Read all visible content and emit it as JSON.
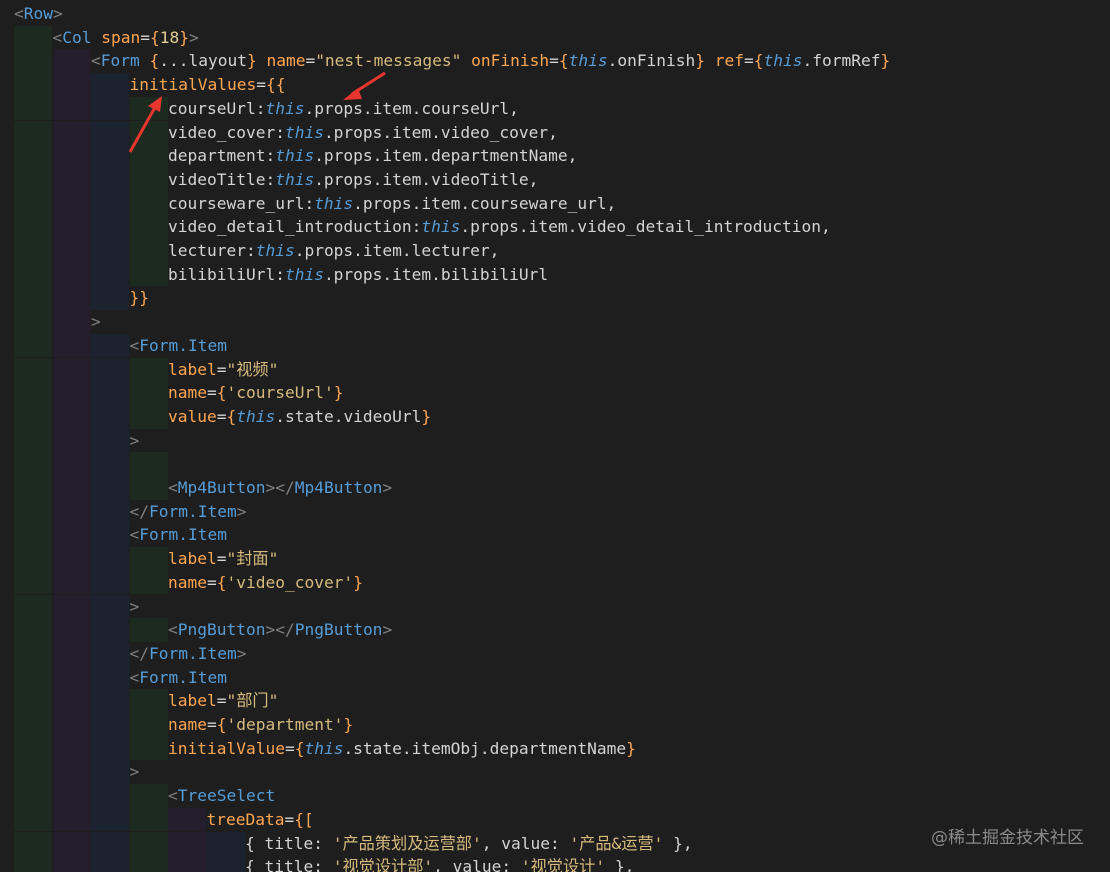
{
  "lines": [
    {
      "indent": 0,
      "tokens": [
        [
          "<",
          "brk"
        ],
        [
          "Row",
          "tagb"
        ],
        [
          ">",
          "brk"
        ]
      ]
    },
    {
      "indent": 1,
      "tokens": [
        [
          "<",
          "brk"
        ],
        [
          "Col",
          "tagb"
        ],
        [
          " ",
          "txt"
        ],
        [
          "span",
          "attr"
        ],
        [
          "=",
          "eq"
        ],
        [
          "{",
          "brace"
        ],
        [
          "18",
          "num"
        ],
        [
          "}",
          "brace"
        ],
        [
          ">",
          "brk"
        ]
      ]
    },
    {
      "indent": 2,
      "tokens": [
        [
          "<",
          "brk"
        ],
        [
          "Form",
          "tagb"
        ],
        [
          " ",
          "txt"
        ],
        [
          "{",
          "brace"
        ],
        [
          "...layout",
          "id"
        ],
        [
          "}",
          "brace"
        ],
        [
          " ",
          "txt"
        ],
        [
          "name",
          "attr"
        ],
        [
          "=",
          "eq"
        ],
        [
          "\"nest-messages\"",
          "str"
        ],
        [
          " ",
          "txt"
        ],
        [
          "onFinish",
          "attr"
        ],
        [
          "=",
          "eq"
        ],
        [
          "{",
          "brace"
        ],
        [
          "this",
          "this"
        ],
        [
          ".onFinish",
          "id"
        ],
        [
          "}",
          "brace"
        ],
        [
          " ",
          "txt"
        ],
        [
          "ref",
          "attr"
        ],
        [
          "=",
          "eq"
        ],
        [
          "{",
          "brace"
        ],
        [
          "this",
          "this"
        ],
        [
          ".formRef",
          "id"
        ],
        [
          "}",
          "brace"
        ]
      ]
    },
    {
      "indent": 3,
      "tokens": [
        [
          "initialValues",
          "attr"
        ],
        [
          "=",
          "eq"
        ],
        [
          "{{",
          "brace"
        ]
      ]
    },
    {
      "indent": 4,
      "tokens": [
        [
          "courseUrl:",
          "id"
        ],
        [
          "this",
          "this"
        ],
        [
          ".props.item.courseUrl,",
          "id"
        ]
      ]
    },
    {
      "indent": 4,
      "tokens": [
        [
          "video_cover:",
          "id"
        ],
        [
          "this",
          "this"
        ],
        [
          ".props.item.video_cover,",
          "id"
        ]
      ]
    },
    {
      "indent": 4,
      "tokens": [
        [
          "department:",
          "id"
        ],
        [
          "this",
          "this"
        ],
        [
          ".props.item.departmentName,",
          "id"
        ]
      ]
    },
    {
      "indent": 4,
      "tokens": [
        [
          "videoTitle:",
          "id"
        ],
        [
          "this",
          "this"
        ],
        [
          ".props.item.videoTitle,",
          "id"
        ]
      ]
    },
    {
      "indent": 4,
      "tokens": [
        [
          "courseware_url:",
          "id"
        ],
        [
          "this",
          "this"
        ],
        [
          ".props.item.courseware_url,",
          "id"
        ]
      ]
    },
    {
      "indent": 4,
      "tokens": [
        [
          "video_detail_introduction:",
          "id"
        ],
        [
          "this",
          "this"
        ],
        [
          ".props.item.video_detail_introduction,",
          "id"
        ]
      ]
    },
    {
      "indent": 4,
      "tokens": [
        [
          "lecturer:",
          "id"
        ],
        [
          "this",
          "this"
        ],
        [
          ".props.item.lecturer,",
          "id"
        ]
      ]
    },
    {
      "indent": 4,
      "tokens": [
        [
          "bilibiliUrl:",
          "id"
        ],
        [
          "this",
          "this"
        ],
        [
          ".props.item.bilibiliUrl",
          "id"
        ]
      ]
    },
    {
      "indent": 3,
      "tokens": [
        [
          "}}",
          "brace"
        ]
      ]
    },
    {
      "indent": 2,
      "tokens": [
        [
          ">",
          "brk"
        ]
      ]
    },
    {
      "indent": 3,
      "tokens": [
        [
          "<",
          "brk"
        ],
        [
          "Form.Item",
          "tagb"
        ]
      ]
    },
    {
      "indent": 4,
      "tokens": [
        [
          "label",
          "attr"
        ],
        [
          "=",
          "eq"
        ],
        [
          "\"视频\"",
          "str"
        ]
      ]
    },
    {
      "indent": 4,
      "tokens": [
        [
          "name",
          "attr"
        ],
        [
          "=",
          "eq"
        ],
        [
          "{",
          "brace"
        ],
        [
          "'courseUrl'",
          "str"
        ],
        [
          "}",
          "brace"
        ]
      ]
    },
    {
      "indent": 4,
      "tokens": [
        [
          "value",
          "attr"
        ],
        [
          "=",
          "eq"
        ],
        [
          "{",
          "brace"
        ],
        [
          "this",
          "this"
        ],
        [
          ".state.videoUrl",
          "id"
        ],
        [
          "}",
          "brace"
        ]
      ]
    },
    {
      "indent": 3,
      "tokens": [
        [
          ">",
          "brk"
        ]
      ]
    },
    {
      "indent": 4,
      "tokens": []
    },
    {
      "indent": 4,
      "tokens": [
        [
          "<",
          "brk"
        ],
        [
          "Mp4Button",
          "tagb"
        ],
        [
          "></",
          "brk"
        ],
        [
          "Mp4Button",
          "tagb"
        ],
        [
          ">",
          "brk"
        ]
      ]
    },
    {
      "indent": 3,
      "tokens": [
        [
          "</",
          "brk"
        ],
        [
          "Form.Item",
          "tagb"
        ],
        [
          ">",
          "brk"
        ]
      ]
    },
    {
      "indent": 3,
      "tokens": [
        [
          "<",
          "brk"
        ],
        [
          "Form.Item",
          "tagb"
        ]
      ]
    },
    {
      "indent": 4,
      "tokens": [
        [
          "label",
          "attr"
        ],
        [
          "=",
          "eq"
        ],
        [
          "\"封面\"",
          "str"
        ]
      ]
    },
    {
      "indent": 4,
      "tokens": [
        [
          "name",
          "attr"
        ],
        [
          "=",
          "eq"
        ],
        [
          "{",
          "brace"
        ],
        [
          "'video_cover'",
          "str"
        ],
        [
          "}",
          "brace"
        ]
      ]
    },
    {
      "indent": 3,
      "tokens": [
        [
          ">",
          "brk"
        ]
      ]
    },
    {
      "indent": 4,
      "tokens": [
        [
          "<",
          "brk"
        ],
        [
          "PngButton",
          "tagb"
        ],
        [
          "></",
          "brk"
        ],
        [
          "PngButton",
          "tagb"
        ],
        [
          ">",
          "brk"
        ]
      ]
    },
    {
      "indent": 3,
      "tokens": [
        [
          "</",
          "brk"
        ],
        [
          "Form.Item",
          "tagb"
        ],
        [
          ">",
          "brk"
        ]
      ]
    },
    {
      "indent": 3,
      "tokens": [
        [
          "<",
          "brk"
        ],
        [
          "Form.Item",
          "tagb"
        ]
      ]
    },
    {
      "indent": 4,
      "tokens": [
        [
          "label",
          "attr"
        ],
        [
          "=",
          "eq"
        ],
        [
          "\"部门\"",
          "str"
        ]
      ]
    },
    {
      "indent": 4,
      "tokens": [
        [
          "name",
          "attr"
        ],
        [
          "=",
          "eq"
        ],
        [
          "{",
          "brace"
        ],
        [
          "'department'",
          "str"
        ],
        [
          "}",
          "brace"
        ]
      ]
    },
    {
      "indent": 4,
      "tokens": [
        [
          "initialValue",
          "attr"
        ],
        [
          "=",
          "eq"
        ],
        [
          "{",
          "brace"
        ],
        [
          "this",
          "this"
        ],
        [
          ".state.itemObj.departmentName",
          "id"
        ],
        [
          "}",
          "brace"
        ]
      ]
    },
    {
      "indent": 3,
      "tokens": [
        [
          ">",
          "brk"
        ]
      ]
    },
    {
      "indent": 4,
      "tokens": [
        [
          "<",
          "brk"
        ],
        [
          "TreeSelect",
          "tagb"
        ]
      ]
    },
    {
      "indent": 5,
      "tokens": [
        [
          "treeData",
          "attr"
        ],
        [
          "=",
          "eq"
        ],
        [
          "{[",
          "brace"
        ]
      ]
    },
    {
      "indent": 6,
      "tokens": [
        [
          "{ title: ",
          "txt"
        ],
        [
          "'产品策划及运营部'",
          "str"
        ],
        [
          ", value: ",
          "txt"
        ],
        [
          "'产品&运营'",
          "str"
        ],
        [
          " },",
          "txt"
        ]
      ]
    },
    {
      "indent": 6,
      "tokens": [
        [
          "{ title: ",
          "txt"
        ],
        [
          "'视觉设计部'",
          "str"
        ],
        [
          ", value: ",
          "txt"
        ],
        [
          "'视觉设计'",
          "str"
        ],
        [
          " },",
          "txt"
        ]
      ]
    }
  ],
  "watermark": "@稀土掘金技术社区",
  "colors": {
    "background": "#1e1e1e",
    "guide1": "#1d2a1f",
    "guide2": "#241d2b",
    "guide3": "#1c2330",
    "arrow": "#e8362f"
  }
}
